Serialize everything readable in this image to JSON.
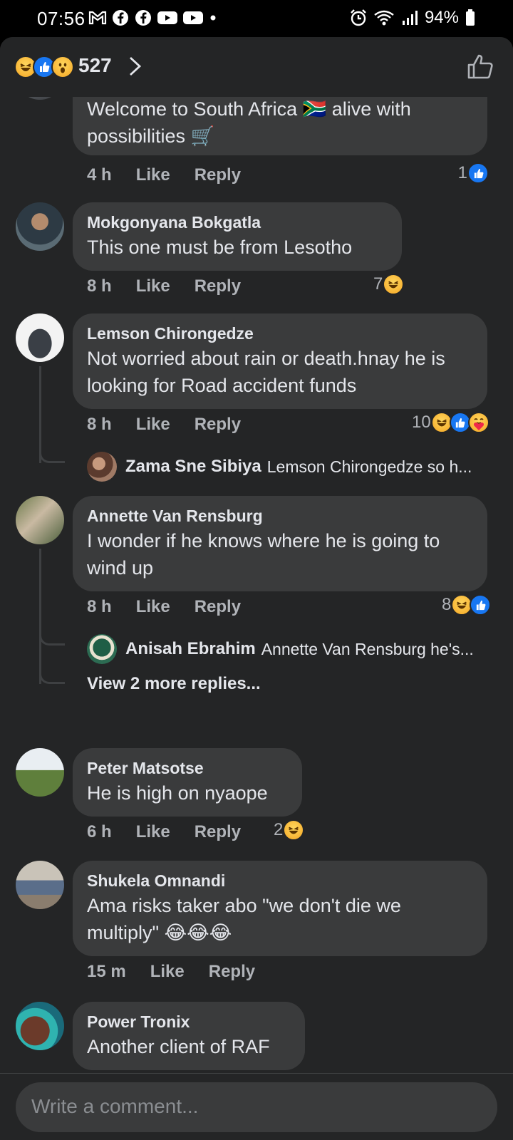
{
  "status_bar": {
    "time": "07:56",
    "battery": "94%",
    "left_icons": [
      "gmail-icon",
      "facebook-icon",
      "facebook-icon",
      "youtube-icon",
      "youtube-icon",
      "dot-icon"
    ],
    "right_icons": [
      "alarm-icon",
      "wifi-icon",
      "signal-icon",
      "battery-icon"
    ]
  },
  "header": {
    "reaction_count": "527",
    "reactions": [
      "laugh",
      "like",
      "wow"
    ]
  },
  "comments": [
    {
      "author": "",
      "text": "Welcome to South Africa 🇿🇦 alive with possibilities 🛒",
      "time": "4 h",
      "like_label": "Like",
      "reply_label": "Reply",
      "reaction_count": "1",
      "reactions": [
        "like"
      ]
    },
    {
      "author": "Mokgonyana Bokgatla",
      "text": "This one must be from Lesotho",
      "time": "8 h",
      "like_label": "Like",
      "reply_label": "Reply",
      "reaction_count": "7",
      "reactions": [
        "laugh"
      ]
    },
    {
      "author": "Lemson Chirongedze",
      "text": "Not worried about rain or death.hnay he is looking for Road accident funds",
      "time": "8 h",
      "like_label": "Like",
      "reply_label": "Reply",
      "reaction_count": "10",
      "reactions": [
        "laugh",
        "like",
        "care"
      ],
      "reply_preview": {
        "author": "Zama Sne Sibiya",
        "text": "Lemson Chirongedze so h..."
      }
    },
    {
      "author": "Annette Van Rensburg",
      "text": "I wonder if he knows where he is going to wind up",
      "time": "8 h",
      "like_label": "Like",
      "reply_label": "Reply",
      "reaction_count": "8",
      "reactions": [
        "laugh",
        "like"
      ],
      "reply_preview": {
        "author": "Anisah Ebrahim",
        "text": "Annette Van Rensburg he's..."
      },
      "view_more": "View 2 more replies..."
    },
    {
      "author": "Peter Matsotse",
      "text": "He is high on nyaope",
      "time": "6 h",
      "like_label": "Like",
      "reply_label": "Reply",
      "reaction_count": "2",
      "reactions": [
        "laugh"
      ]
    },
    {
      "author": "Shukela Omnandi",
      "text": "Ama risks taker abo \"we don't die we multiply\" 😂😂😂",
      "time": "15 m",
      "like_label": "Like",
      "reply_label": "Reply"
    },
    {
      "author": "Power Tronix",
      "text": "Another client of RAF"
    }
  ],
  "composer": {
    "placeholder": "Write a comment..."
  },
  "colors": {
    "panel": "#242526",
    "bubble": "#3a3b3c",
    "text": "#e4e6eb",
    "muted": "#b0b3b8",
    "like_blue": "#1877f2",
    "laugh_yellow": "#f7b928"
  }
}
